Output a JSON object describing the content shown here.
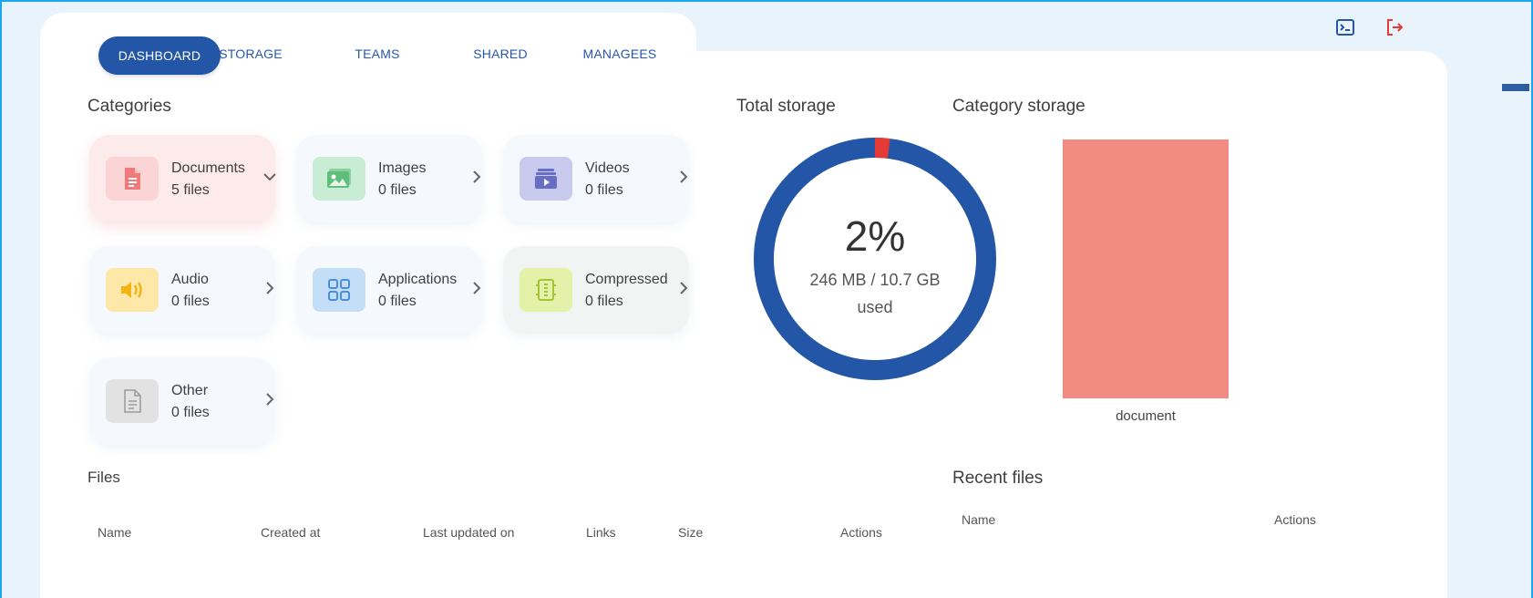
{
  "tabs": [
    {
      "label": "DASHBOARD",
      "active": true
    },
    {
      "label": "STORAGE"
    },
    {
      "label": "TEAMS"
    },
    {
      "label": "SHARED"
    },
    {
      "label": "MANAGEES"
    }
  ],
  "top_icons": [
    {
      "name": "terminal-icon",
      "color": "#2356a6"
    },
    {
      "name": "logout-icon",
      "color": "#e53935"
    }
  ],
  "categories": {
    "title": "Categories",
    "items": [
      {
        "name": "Documents",
        "count": "5 files",
        "icon": "document-icon",
        "color": "#f07a7a",
        "bg": "#fbd5d5",
        "expanded": true
      },
      {
        "name": "Images",
        "count": "0 files",
        "icon": "image-icon",
        "color": "#5fbf7a",
        "bg": "#c8ecd4"
      },
      {
        "name": "Videos",
        "count": "0 files",
        "icon": "video-icon",
        "color": "#6a6dc4",
        "bg": "#c9cbee"
      },
      {
        "name": "Audio",
        "count": "0 files",
        "icon": "audio-icon",
        "color": "#f3b515",
        "bg": "#fde7a9"
      },
      {
        "name": "Applications",
        "count": "0 files",
        "icon": "applications-icon",
        "color": "#4a8fdc",
        "bg": "#c5def7"
      },
      {
        "name": "Compressed",
        "count": "0 files",
        "icon": "compressed-icon",
        "color": "#a5c436",
        "bg": "#e5f1a8"
      },
      {
        "name": "Other",
        "count": "0 files",
        "icon": "other-file-icon",
        "color": "#9a9a9a",
        "bg": "#e2e2e2"
      }
    ]
  },
  "total_storage": {
    "title": "Total storage",
    "percent_label": "2%",
    "used_label": "246 MB / 10.7 GB",
    "used_word": "used",
    "percent": 2,
    "fill_color": "#2356a6",
    "used_color": "#e53935"
  },
  "category_storage": {
    "title": "Category storage",
    "bar_label": "document",
    "bar_color": "#f28b82"
  },
  "files": {
    "title": "Files",
    "columns": [
      "Name",
      "Created at",
      "Last updated on",
      "Links",
      "Size",
      "Actions"
    ]
  },
  "recent_files": {
    "title": "Recent files",
    "columns": [
      "Name",
      "Actions"
    ]
  }
}
